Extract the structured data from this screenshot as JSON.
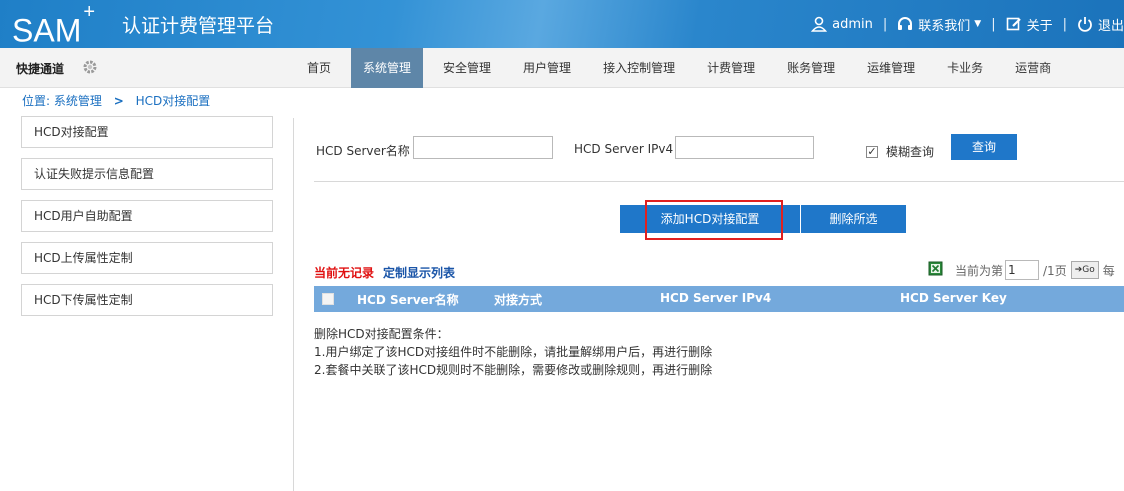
{
  "header": {
    "logo_text": "SAM",
    "logo_sup": "+",
    "platform_title": "认证计费管理平台",
    "user": "admin",
    "contact": "联系我们",
    "about": "关于",
    "logout": "退出"
  },
  "nav": {
    "quick_access": "快捷通道",
    "items": [
      "首页",
      "系统管理",
      "安全管理",
      "用户管理",
      "接入控制管理",
      "计费管理",
      "账务管理",
      "运维管理",
      "卡业务",
      "运营商"
    ],
    "active": "系统管理"
  },
  "breadcrumb": {
    "prefix": "位置:",
    "section": "系统管理",
    "separator": ">",
    "page": "HCD对接配置"
  },
  "sidebar": {
    "items": [
      "HCD对接配置",
      "认证失败提示信息配置",
      "HCD用户自助配置",
      "HCD上传属性定制",
      "HCD下传属性定制"
    ]
  },
  "search": {
    "name_label": "HCD Server名称",
    "name_value": "",
    "ip_label": "HCD Server IPv4",
    "ip_value": "",
    "fuzzy_label": "模糊查询",
    "fuzzy_checked": true,
    "query_button": "查询"
  },
  "actions": {
    "add_button": "添加HCD对接配置",
    "delete_button": "删除所选"
  },
  "list": {
    "no_records": "当前无记录",
    "custom_columns": "定制显示列表",
    "pager": {
      "prefix": "当前为第",
      "page_value": "1",
      "total": "/1页",
      "go": "Go",
      "per": "每"
    },
    "columns": [
      "HCD Server名称",
      "对接方式",
      "HCD Server IPv4",
      "HCD Server Key"
    ]
  },
  "notes": {
    "title": "删除HCD对接配置条件：",
    "lines": [
      "1.用户绑定了该HCD对接组件时不能删除，请批量解绑用户后，再进行删除",
      "2.套餐中关联了该HCD规则时不能删除，需要修改或删除规则，再进行删除"
    ]
  },
  "colors": {
    "header_blue": "#1f7fc7",
    "button_blue": "#1f77c9",
    "table_header": "#74a9dc",
    "active_nav": "#5e86a8",
    "highlight_red": "#e02020"
  }
}
